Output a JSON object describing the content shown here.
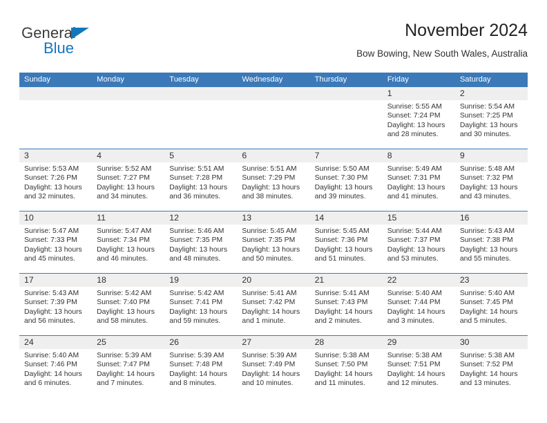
{
  "brand": {
    "name_part1": "General",
    "name_part2": "Blue",
    "color_dark": "#3c3c3c",
    "color_blue": "#1277bd"
  },
  "header": {
    "title": "November 2024",
    "subtitle": "Bow Bowing, New South Wales, Australia",
    "header_bg": "#3b79b8",
    "daynum_band_bg": "#efefef"
  },
  "weekdays": [
    "Sunday",
    "Monday",
    "Tuesday",
    "Wednesday",
    "Thursday",
    "Friday",
    "Saturday"
  ],
  "weeks": [
    [
      {
        "day": "",
        "empty": true
      },
      {
        "day": "",
        "empty": true
      },
      {
        "day": "",
        "empty": true
      },
      {
        "day": "",
        "empty": true
      },
      {
        "day": "",
        "empty": true
      },
      {
        "day": "1",
        "sunrise": "Sunrise: 5:55 AM",
        "sunset": "Sunset: 7:24 PM",
        "daylight": "Daylight: 13 hours and 28 minutes."
      },
      {
        "day": "2",
        "sunrise": "Sunrise: 5:54 AM",
        "sunset": "Sunset: 7:25 PM",
        "daylight": "Daylight: 13 hours and 30 minutes."
      }
    ],
    [
      {
        "day": "3",
        "sunrise": "Sunrise: 5:53 AM",
        "sunset": "Sunset: 7:26 PM",
        "daylight": "Daylight: 13 hours and 32 minutes."
      },
      {
        "day": "4",
        "sunrise": "Sunrise: 5:52 AM",
        "sunset": "Sunset: 7:27 PM",
        "daylight": "Daylight: 13 hours and 34 minutes."
      },
      {
        "day": "5",
        "sunrise": "Sunrise: 5:51 AM",
        "sunset": "Sunset: 7:28 PM",
        "daylight": "Daylight: 13 hours and 36 minutes."
      },
      {
        "day": "6",
        "sunrise": "Sunrise: 5:51 AM",
        "sunset": "Sunset: 7:29 PM",
        "daylight": "Daylight: 13 hours and 38 minutes."
      },
      {
        "day": "7",
        "sunrise": "Sunrise: 5:50 AM",
        "sunset": "Sunset: 7:30 PM",
        "daylight": "Daylight: 13 hours and 39 minutes."
      },
      {
        "day": "8",
        "sunrise": "Sunrise: 5:49 AM",
        "sunset": "Sunset: 7:31 PM",
        "daylight": "Daylight: 13 hours and 41 minutes."
      },
      {
        "day": "9",
        "sunrise": "Sunrise: 5:48 AM",
        "sunset": "Sunset: 7:32 PM",
        "daylight": "Daylight: 13 hours and 43 minutes."
      }
    ],
    [
      {
        "day": "10",
        "sunrise": "Sunrise: 5:47 AM",
        "sunset": "Sunset: 7:33 PM",
        "daylight": "Daylight: 13 hours and 45 minutes."
      },
      {
        "day": "11",
        "sunrise": "Sunrise: 5:47 AM",
        "sunset": "Sunset: 7:34 PM",
        "daylight": "Daylight: 13 hours and 46 minutes."
      },
      {
        "day": "12",
        "sunrise": "Sunrise: 5:46 AM",
        "sunset": "Sunset: 7:35 PM",
        "daylight": "Daylight: 13 hours and 48 minutes."
      },
      {
        "day": "13",
        "sunrise": "Sunrise: 5:45 AM",
        "sunset": "Sunset: 7:35 PM",
        "daylight": "Daylight: 13 hours and 50 minutes."
      },
      {
        "day": "14",
        "sunrise": "Sunrise: 5:45 AM",
        "sunset": "Sunset: 7:36 PM",
        "daylight": "Daylight: 13 hours and 51 minutes."
      },
      {
        "day": "15",
        "sunrise": "Sunrise: 5:44 AM",
        "sunset": "Sunset: 7:37 PM",
        "daylight": "Daylight: 13 hours and 53 minutes."
      },
      {
        "day": "16",
        "sunrise": "Sunrise: 5:43 AM",
        "sunset": "Sunset: 7:38 PM",
        "daylight": "Daylight: 13 hours and 55 minutes."
      }
    ],
    [
      {
        "day": "17",
        "sunrise": "Sunrise: 5:43 AM",
        "sunset": "Sunset: 7:39 PM",
        "daylight": "Daylight: 13 hours and 56 minutes."
      },
      {
        "day": "18",
        "sunrise": "Sunrise: 5:42 AM",
        "sunset": "Sunset: 7:40 PM",
        "daylight": "Daylight: 13 hours and 58 minutes."
      },
      {
        "day": "19",
        "sunrise": "Sunrise: 5:42 AM",
        "sunset": "Sunset: 7:41 PM",
        "daylight": "Daylight: 13 hours and 59 minutes."
      },
      {
        "day": "20",
        "sunrise": "Sunrise: 5:41 AM",
        "sunset": "Sunset: 7:42 PM",
        "daylight": "Daylight: 14 hours and 1 minute."
      },
      {
        "day": "21",
        "sunrise": "Sunrise: 5:41 AM",
        "sunset": "Sunset: 7:43 PM",
        "daylight": "Daylight: 14 hours and 2 minutes."
      },
      {
        "day": "22",
        "sunrise": "Sunrise: 5:40 AM",
        "sunset": "Sunset: 7:44 PM",
        "daylight": "Daylight: 14 hours and 3 minutes."
      },
      {
        "day": "23",
        "sunrise": "Sunrise: 5:40 AM",
        "sunset": "Sunset: 7:45 PM",
        "daylight": "Daylight: 14 hours and 5 minutes."
      }
    ],
    [
      {
        "day": "24",
        "sunrise": "Sunrise: 5:40 AM",
        "sunset": "Sunset: 7:46 PM",
        "daylight": "Daylight: 14 hours and 6 minutes."
      },
      {
        "day": "25",
        "sunrise": "Sunrise: 5:39 AM",
        "sunset": "Sunset: 7:47 PM",
        "daylight": "Daylight: 14 hours and 7 minutes."
      },
      {
        "day": "26",
        "sunrise": "Sunrise: 5:39 AM",
        "sunset": "Sunset: 7:48 PM",
        "daylight": "Daylight: 14 hours and 8 minutes."
      },
      {
        "day": "27",
        "sunrise": "Sunrise: 5:39 AM",
        "sunset": "Sunset: 7:49 PM",
        "daylight": "Daylight: 14 hours and 10 minutes."
      },
      {
        "day": "28",
        "sunrise": "Sunrise: 5:38 AM",
        "sunset": "Sunset: 7:50 PM",
        "daylight": "Daylight: 14 hours and 11 minutes."
      },
      {
        "day": "29",
        "sunrise": "Sunrise: 5:38 AM",
        "sunset": "Sunset: 7:51 PM",
        "daylight": "Daylight: 14 hours and 12 minutes."
      },
      {
        "day": "30",
        "sunrise": "Sunrise: 5:38 AM",
        "sunset": "Sunset: 7:52 PM",
        "daylight": "Daylight: 14 hours and 13 minutes."
      }
    ]
  ]
}
